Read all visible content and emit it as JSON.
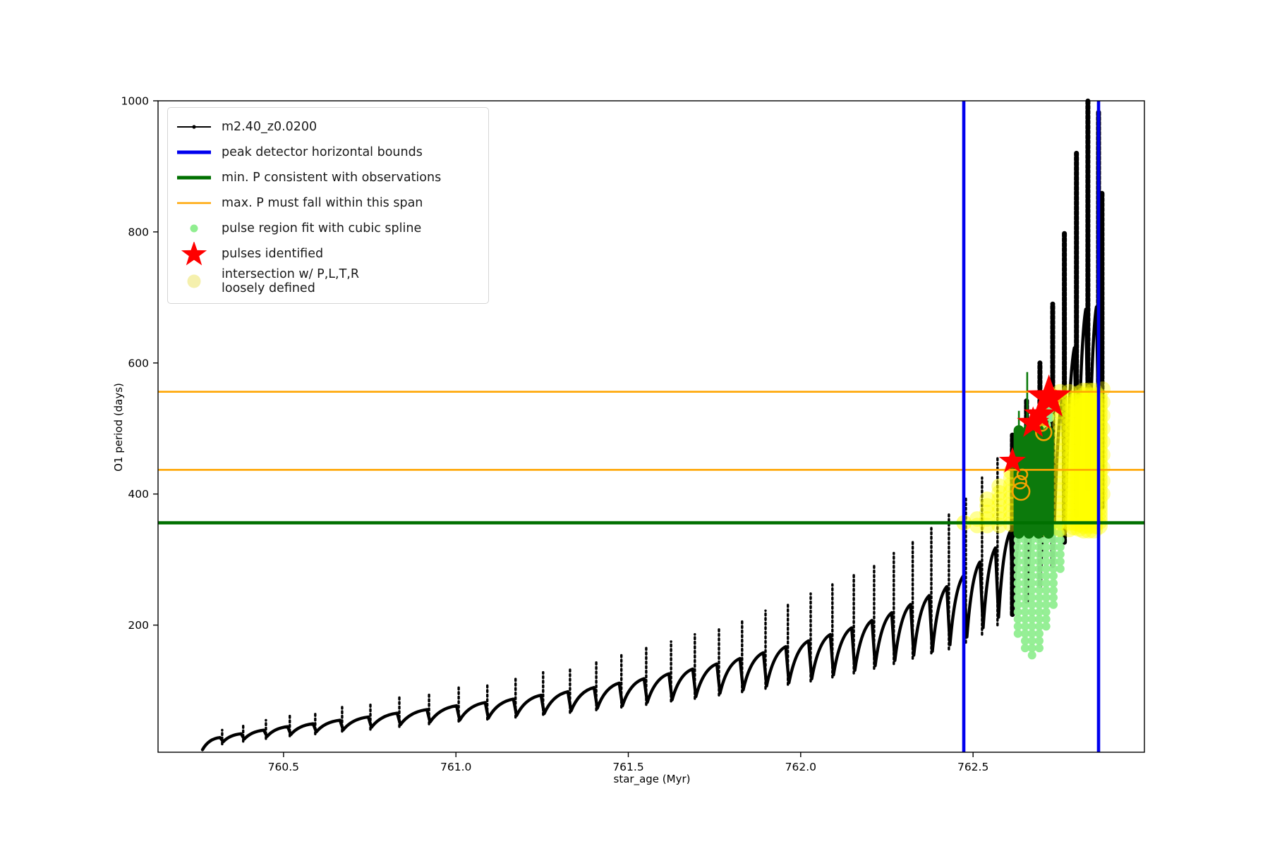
{
  "chart_data": {
    "type": "line",
    "title": "",
    "xlabel": "star_age (Myr)",
    "ylabel": "O1 period (days)",
    "xlim": [
      760.136,
      762.997
    ],
    "ylim": [
      6,
      1000
    ],
    "grid": false,
    "x_ticks": [
      {
        "v": 760.5,
        "label": "760.5"
      },
      {
        "v": 761.0,
        "label": "761.0"
      },
      {
        "v": 761.5,
        "label": "761.5"
      },
      {
        "v": 762.0,
        "label": "762.0"
      },
      {
        "v": 762.5,
        "label": "762.5"
      }
    ],
    "y_ticks": [
      {
        "v": 200,
        "label": "200"
      },
      {
        "v": 400,
        "label": "400"
      },
      {
        "v": 600,
        "label": "600"
      },
      {
        "v": 800,
        "label": "800"
      },
      {
        "v": 1000,
        "label": "1000"
      }
    ],
    "colors": {
      "series": "#000000",
      "peak_bounds": "#0000ee",
      "min_p": "#007000",
      "max_p": "#ffa500",
      "spline_fit": "#90ee90",
      "pulses": "#ff0000",
      "intersection": "#ffff00",
      "intersection_legend": "#f5f0ad"
    },
    "series_label": "m2.40_z0.0200",
    "series_start": 760.265,
    "pulse_cycles": [
      [
        760.322,
        18,
        40
      ],
      [
        760.383,
        22,
        48
      ],
      [
        760.449,
        26,
        55
      ],
      [
        760.518,
        30,
        62
      ],
      [
        760.592,
        33,
        68
      ],
      [
        760.67,
        37,
        75
      ],
      [
        760.752,
        40,
        82
      ],
      [
        760.836,
        44,
        90
      ],
      [
        760.922,
        48,
        97
      ],
      [
        761.008,
        52,
        105
      ],
      [
        761.091,
        55,
        112
      ],
      [
        761.173,
        58,
        120
      ],
      [
        761.253,
        62,
        128
      ],
      [
        761.331,
        65,
        136
      ],
      [
        761.407,
        69,
        145
      ],
      [
        761.48,
        73,
        155
      ],
      [
        761.552,
        77,
        165
      ],
      [
        761.624,
        82,
        175
      ],
      [
        761.693,
        86,
        186
      ],
      [
        761.763,
        91,
        197
      ],
      [
        761.83,
        96,
        209
      ],
      [
        761.898,
        101,
        222
      ],
      [
        761.963,
        107,
        235
      ],
      [
        762.029,
        112,
        248
      ],
      [
        762.092,
        118,
        262
      ],
      [
        762.154,
        124,
        277
      ],
      [
        762.213,
        131,
        293
      ],
      [
        762.27,
        138,
        310
      ],
      [
        762.325,
        146,
        328
      ],
      [
        762.379,
        154,
        348
      ],
      [
        762.43,
        160,
        370
      ],
      [
        762.479,
        170,
        395
      ],
      [
        762.526,
        182,
        425
      ],
      [
        762.571,
        196,
        455
      ],
      [
        762.614,
        212,
        490
      ],
      [
        762.655,
        232,
        545
      ],
      [
        762.694,
        255,
        600
      ],
      [
        762.731,
        285,
        690
      ],
      [
        762.765,
        320,
        800
      ],
      [
        762.8,
        360,
        920
      ],
      [
        762.833,
        400,
        1000
      ],
      [
        762.864,
        420,
        985
      ]
    ],
    "post_column": {
      "x": 762.874,
      "top": 860,
      "bottom": 380
    },
    "vlines": {
      "x": [
        762.473,
        762.864
      ]
    },
    "hlines": {
      "min_p": 356,
      "max_p": [
        437,
        556
      ]
    },
    "scatter": {
      "lightgreen": {
        "r": 6,
        "opacity": 0.95,
        "columns": [
          {
            "x": 762.63,
            "top": 352,
            "bottom": 185
          },
          {
            "x": 762.651,
            "top": 352,
            "bottom": 160
          },
          {
            "x": 762.671,
            "top": 352,
            "bottom": 150
          },
          {
            "x": 762.692,
            "top": 352,
            "bottom": 165
          },
          {
            "x": 762.712,
            "top": 352,
            "bottom": 190
          },
          {
            "x": 762.733,
            "top": 352,
            "bottom": 230
          },
          {
            "x": 762.753,
            "top": 352,
            "bottom": 278
          }
        ],
        "dots": [
          [
            762.722,
            529
          ],
          [
            762.722,
            517
          ],
          [
            762.712,
            505
          ]
        ]
      },
      "yellow": {
        "r": 11,
        "opacity": 0.42,
        "columns": [
          {
            "x": 762.512,
            "top": 362,
            "bottom": 346
          },
          {
            "x": 762.541,
            "top": 392,
            "bottom": 346
          },
          {
            "x": 762.576,
            "top": 412,
            "bottom": 346
          },
          {
            "x": 762.61,
            "top": 434,
            "bottom": 346
          },
          {
            "x": 762.647,
            "top": 462,
            "bottom": 346
          },
          {
            "x": 762.676,
            "top": 480,
            "bottom": 346
          },
          {
            "x": 762.705,
            "top": 497,
            "bottom": 346
          },
          {
            "x": 762.752,
            "top": 556,
            "bottom": 346
          },
          {
            "x": 762.779,
            "top": 556,
            "bottom": 346
          },
          {
            "x": 762.793,
            "top": 540,
            "bottom": 346,
            "solid": true
          },
          {
            "x": 762.807,
            "top": 552,
            "bottom": 346,
            "solid": true
          },
          {
            "x": 762.821,
            "top": 556,
            "bottom": 346,
            "solid": true
          },
          {
            "x": 762.836,
            "top": 556,
            "bottom": 346,
            "solid": true
          },
          {
            "x": 762.85,
            "top": 556,
            "bottom": 346,
            "solid": true
          },
          {
            "x": 762.864,
            "top": 548,
            "bottom": 346,
            "solid": true
          },
          {
            "x": 762.876,
            "top": 560,
            "bottom": 382,
            "sparse": true
          }
        ],
        "dots": [
          [
            762.474,
            356
          ]
        ]
      },
      "darkgreen": {
        "r": 7.5,
        "columns": [
          {
            "x": 762.633,
            "top": 497,
            "bottom": 340
          },
          {
            "x": 762.662,
            "top": 500,
            "bottom": 340
          },
          {
            "x": 762.69,
            "top": 498,
            "bottom": 340
          },
          {
            "x": 762.719,
            "top": 495,
            "bottom": 340
          }
        ],
        "spikes": [
          {
            "x": 762.633,
            "top": 527,
            "bottom": 400
          },
          {
            "x": 762.657,
            "top": 586,
            "bottom": 400
          },
          {
            "x": 762.686,
            "top": 512,
            "bottom": 400
          },
          {
            "x": 762.716,
            "top": 512,
            "bottom": 400
          }
        ]
      },
      "orange_rings": [
        {
          "x": 762.639,
          "y": 404,
          "r": 12
        },
        {
          "x": 762.636,
          "y": 418,
          "r": 9
        },
        {
          "x": 762.643,
          "y": 430,
          "r": 7
        },
        {
          "x": 762.7,
          "y": 505,
          "r": 8
        },
        {
          "x": 762.705,
          "y": 494,
          "r": 11
        },
        {
          "x": 762.724,
          "y": 536,
          "r": 9
        },
        {
          "x": 762.727,
          "y": 547,
          "r": 12
        },
        {
          "x": 762.721,
          "y": 557,
          "r": 7
        }
      ],
      "stars": [
        {
          "x": 762.614,
          "y": 450,
          "size": 20
        },
        {
          "x": 762.674,
          "y": 508,
          "size": 24
        },
        {
          "x": 762.694,
          "y": 521,
          "size": 24
        },
        {
          "x": 762.72,
          "y": 547,
          "size": 33
        }
      ]
    },
    "legend": {
      "items": [
        {
          "type": "line-marker",
          "label": "m2.40_z0.0200"
        },
        {
          "type": "line-blue",
          "label": "peak detector horizontal bounds"
        },
        {
          "type": "line-green",
          "label": "min. P consistent with observations"
        },
        {
          "type": "line-orange",
          "label": "max. P must fall within this span"
        },
        {
          "type": "dot-lightgreen",
          "label": "pulse region fit with cubic spline"
        },
        {
          "type": "star-red",
          "label": "pulses identified"
        },
        {
          "type": "dot-paleyellow",
          "label": "intersection w/ P,L,T,R\nloosely defined"
        }
      ]
    }
  }
}
